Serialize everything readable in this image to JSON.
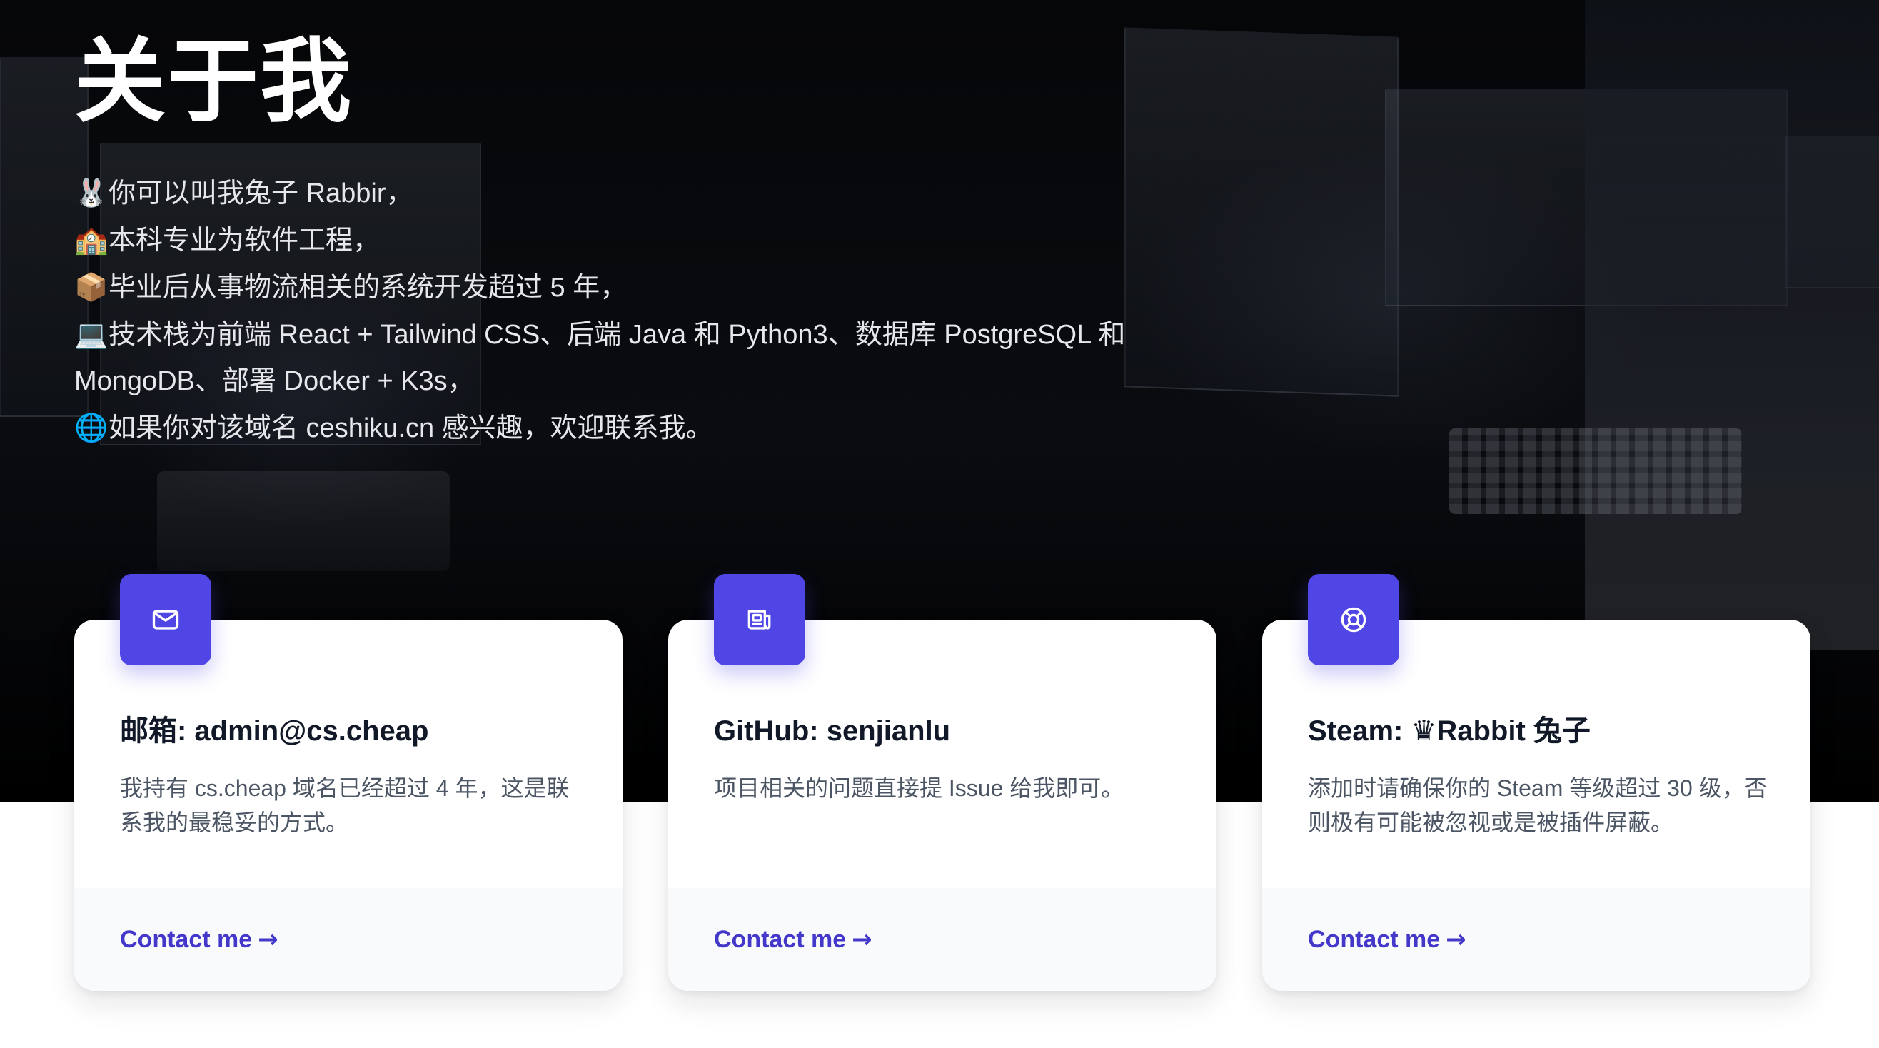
{
  "header": {
    "title": "关于我"
  },
  "intro": {
    "lines": [
      {
        "emoji": "🐰",
        "text": "你可以叫我兔子 Rabbir，"
      },
      {
        "emoji": "🏫",
        "text": "本科专业为软件工程，"
      },
      {
        "emoji": "📦",
        "text": "毕业后从事物流相关的系统开发超过 5 年，"
      },
      {
        "emoji": "💻",
        "text": "技术栈为前端 React + Tailwind CSS、后端 Java 和 Python3、数据库 PostgreSQL 和 MongoDB、部署 Docker + K3s，"
      },
      {
        "emoji": "🌐",
        "text": "如果你对该域名 ceshiku.cn 感兴趣，欢迎联系我。"
      }
    ]
  },
  "cards": [
    {
      "icon": "mail-icon",
      "title": "邮箱: admin@cs.cheap",
      "description": "我持有 cs.cheap 域名已经超过 4 年，这是联系我的最稳妥的方式。",
      "link_label": "Contact me",
      "link_arrow": "→"
    },
    {
      "icon": "newspaper-icon",
      "title": "GitHub: senjianlu",
      "description": "项目相关的问题直接提 Issue 给我即可。",
      "link_label": "Contact me",
      "link_arrow": "→"
    },
    {
      "icon": "lifebuoy-icon",
      "title": "Steam: ♛Rabbit 兔子",
      "description": "添加时请确保你的 Steam 等级超过 30 级，否则极有可能被忽视或是被插件屏蔽。",
      "link_label": "Contact me",
      "link_arrow": "→"
    }
  ],
  "colors": {
    "accent": "#4f46e5",
    "link": "#4338ca",
    "hero_bg": "#050608",
    "card_footer_bg": "#f9fafb"
  }
}
